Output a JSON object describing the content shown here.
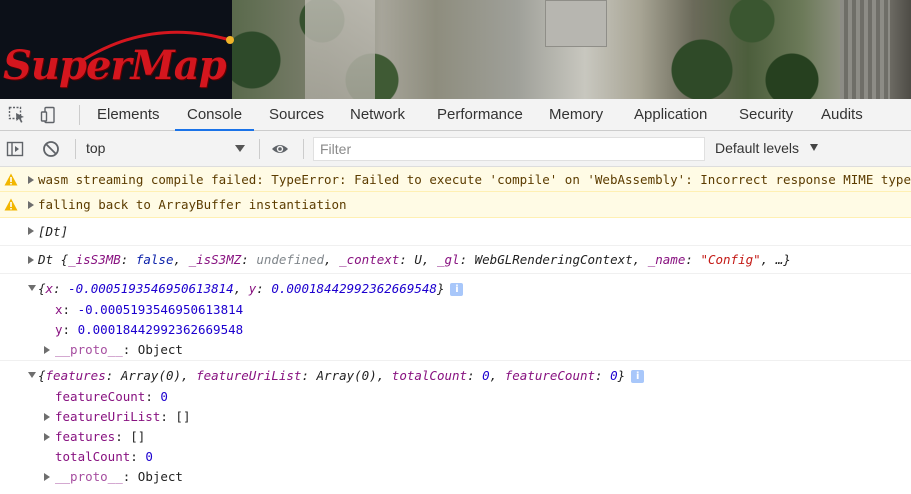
{
  "map": {
    "logo_text": "SuperMap",
    "logo_color": "#d4161e"
  },
  "devtools": {
    "tabs": [
      {
        "label": "Elements"
      },
      {
        "label": "Console",
        "active": true
      },
      {
        "label": "Sources"
      },
      {
        "label": "Network"
      },
      {
        "label": "Performance"
      },
      {
        "label": "Memory"
      },
      {
        "label": "Application"
      },
      {
        "label": "Security"
      },
      {
        "label": "Audits"
      }
    ],
    "accent_color": "#1a73e8"
  },
  "console_toolbar": {
    "context": "top",
    "filter_placeholder": "Filter",
    "levels": "Default levels"
  },
  "messages": {
    "warn1": "wasm streaming compile failed: TypeError: Failed to execute 'compile' on 'WebAssembly': Incorrect response MIME type. Expected 'application/wasm'.",
    "warn2": "falling back to ArrayBuffer instantiation",
    "dt_array": "[Dt]",
    "dt_object": {
      "prefix": "Dt {",
      "k1": "_isS3MB",
      "v1": "false",
      "k2": "_isS3MZ",
      "v2": "undefined",
      "k3": "_context",
      "v3": "U",
      "k4": "_gl",
      "v4": "WebGLRenderingContext",
      "k5": "_name",
      "v5": "\"Config\"",
      "suffix": ", …}"
    },
    "coord": {
      "summary_k1": "x",
      "summary_v1": "-0.0005193546950613814",
      "summary_k2": "y",
      "summary_v2": "0.00018442992362669548",
      "x_key": "x",
      "x_val": "-0.0005193546950613814",
      "y_key": "y",
      "y_val": "0.00018442992362669548",
      "proto_key": "__proto__",
      "proto_val": "Object"
    },
    "features": {
      "summary_k1": "features",
      "summary_v1": "Array(0)",
      "summary_k2": "featureUriList",
      "summary_v2": "Array(0)",
      "summary_k3": "totalCount",
      "summary_v3": "0",
      "summary_k4": "featureCount",
      "summary_v4": "0",
      "featureCount_key": "featureCount",
      "featureCount_val": "0",
      "featureUriList_key": "featureUriList",
      "featureUriList_val": "[]",
      "features_key": "features",
      "features_val": "[]",
      "totalCount_key": "totalCount",
      "totalCount_val": "0",
      "proto_key": "__proto__",
      "proto_val": "Object"
    }
  }
}
